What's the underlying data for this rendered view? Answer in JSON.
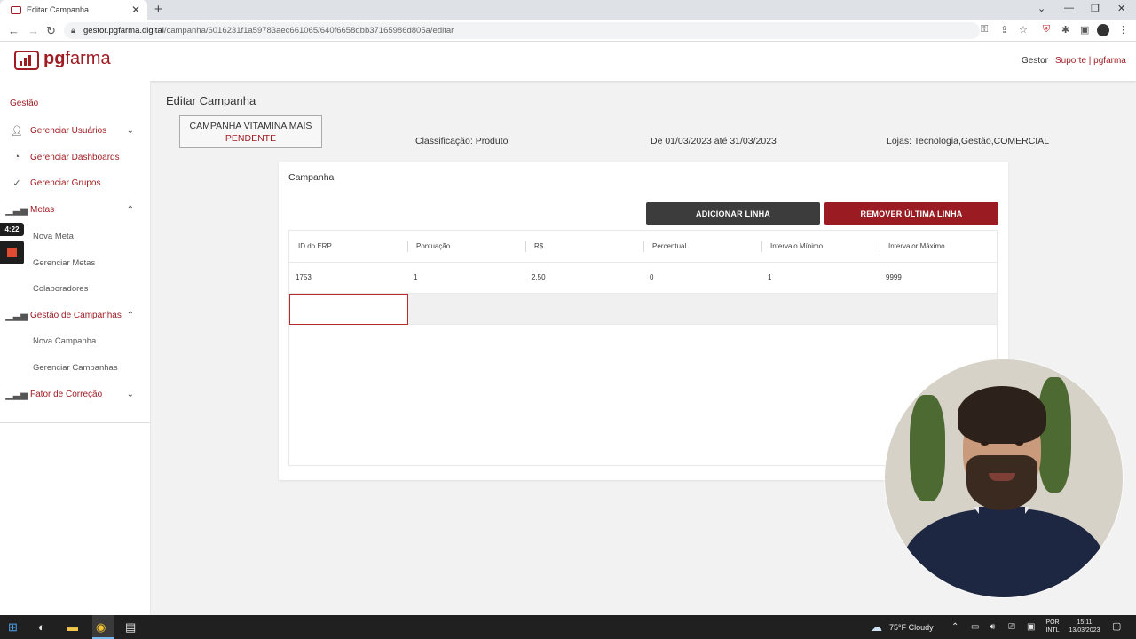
{
  "browser": {
    "tab_title": "Editar Campanha",
    "tab_close": "✕",
    "new_tab": "+",
    "url_domain": "gestor.pgfarma.digital",
    "url_path": "/campanha/6016231f1a59783aec661065/640f6658dbb37165986d805a/editar",
    "icons": [
      "back-icon",
      "forward-icon",
      "reload-icon",
      "lock-icon",
      "key-icon",
      "share-icon",
      "star-icon",
      "shield-icon",
      "puzzle-icon",
      "sidepanel-icon",
      "menu-icon"
    ]
  },
  "header": {
    "logo_bold": "pg",
    "logo_rest": "farma",
    "gestor_link": "Gestor",
    "suporte_link": "Suporte | pgfarma"
  },
  "sidebar": {
    "section_title": "Gestão",
    "items": [
      {
        "label": "Gerenciar Usuários",
        "icon": "add-user-icon"
      },
      {
        "label": "Gerenciar Dashboards",
        "icon": "pie-chart-icon"
      },
      {
        "label": "Gerenciar Grupos",
        "icon": "check-circle-icon"
      },
      {
        "label": "Metas",
        "icon": "bar-chart-icon"
      },
      {
        "label": "Gestão de Campanhas",
        "icon": "bar-chart-icon"
      },
      {
        "label": "Fator de Correção",
        "icon": "bar-chart-icon"
      }
    ],
    "metas_sub": [
      "Nova Meta",
      "Gerenciar Metas",
      "Colaboradores"
    ],
    "campanhas_sub": [
      "Nova Campanha",
      "Gerenciar Campanhas"
    ]
  },
  "recorder": {
    "time": "4:22"
  },
  "main": {
    "page_title": "Editar Campanha",
    "campaign_name": "CAMPANHA VITAMINA MAIS",
    "campaign_status": "PENDENTE",
    "classificacao": "Classificação: Produto",
    "periodo": "De 01/03/2023 até 31/03/2023",
    "lojas": "Lojas: Tecnologia,Gestão,COMERCIAL",
    "card_title": "Campanha",
    "add_button": "ADICIONAR LINHA",
    "remove_button": "REMOVER ÚLTIMA LINHA",
    "columns": [
      "ID do ERP",
      "Pontuação",
      "R$",
      "Percentual",
      "Intervalo Mínimo",
      "Intervalor Máximo"
    ],
    "rows": [
      [
        "1753",
        "1",
        "2,50",
        "0",
        "1",
        "9999"
      ]
    ],
    "accent_color": "#a01c23"
  },
  "taskbar": {
    "weather": "75°F  Cloudy",
    "lang_top": "POR",
    "lang_bottom": "INTL",
    "time": "15:11",
    "date": "13/03/2023"
  }
}
